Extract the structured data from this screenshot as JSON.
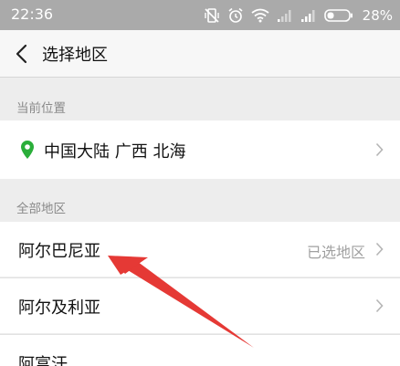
{
  "status_bar": {
    "time": "22:36",
    "battery": "28%",
    "icons": [
      "vibrate-off-icon",
      "alarm-icon",
      "wifi-icon",
      "signal-icon",
      "signal-icon",
      "battery-icon"
    ]
  },
  "header": {
    "title": "选择地区",
    "back_icon": "chevron-left-icon"
  },
  "current_section": {
    "label": "当前位置",
    "location": "中国大陆 广西 北海",
    "icon": "location-pin-icon",
    "pin_color": "#2aae3a"
  },
  "all_section": {
    "label": "全部地区"
  },
  "regions": [
    {
      "name": "阿尔巴尼亚",
      "status": "已选地区"
    },
    {
      "name": "阿尔及利亚",
      "status": ""
    },
    {
      "name": "阿富汗",
      "status": ""
    }
  ],
  "colors": {
    "status_bar": "#aaaaaa",
    "annotation_arrow": "#e53935"
  }
}
